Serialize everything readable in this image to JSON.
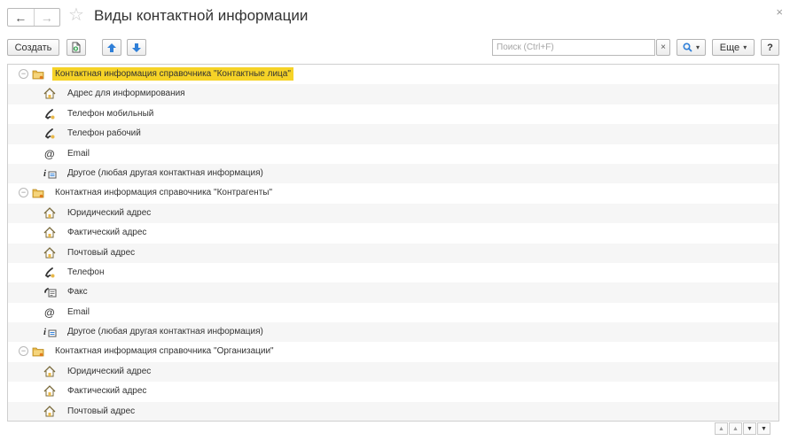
{
  "window": {
    "back_label": "←",
    "forward_label": "→",
    "favorite_glyph": "☆",
    "title": "Виды контактной информации",
    "close_glyph": "×"
  },
  "toolbar": {
    "create_label": "Создать",
    "search_placeholder": "Поиск (Ctrl+F)",
    "clear_glyph": "×",
    "more_label": "Еще",
    "help_label": "?"
  },
  "groups": [
    {
      "label": "Контактная информация справочника \"Контактные лица\"",
      "selected": true,
      "items": [
        {
          "label": "Адрес для информирования",
          "icon": "address-icon"
        },
        {
          "label": "Телефон мобильный",
          "icon": "phone-icon"
        },
        {
          "label": "Телефон рабочий",
          "icon": "phone-icon"
        },
        {
          "label": "Email",
          "icon": "email-icon"
        },
        {
          "label": "Другое (любая другая контактная информация)",
          "icon": "other-info-icon"
        }
      ]
    },
    {
      "label": "Контактная информация справочника \"Контрагенты\"",
      "selected": false,
      "items": [
        {
          "label": "Юридический адрес",
          "icon": "address-icon"
        },
        {
          "label": "Фактический адрес",
          "icon": "address-icon"
        },
        {
          "label": "Почтовый адрес",
          "icon": "address-icon"
        },
        {
          "label": "Телефон",
          "icon": "phone-icon"
        },
        {
          "label": "Факс",
          "icon": "fax-icon"
        },
        {
          "label": "Email",
          "icon": "email-icon"
        },
        {
          "label": "Другое (любая другая контактная информация)",
          "icon": "other-info-icon"
        }
      ]
    },
    {
      "label": "Контактная информация справочника \"Организации\"",
      "selected": false,
      "items": [
        {
          "label": "Юридический адрес",
          "icon": "address-icon"
        },
        {
          "label": "Фактический адрес",
          "icon": "address-icon"
        },
        {
          "label": "Почтовый адрес",
          "icon": "address-icon"
        }
      ]
    }
  ],
  "colors": {
    "selection": "#f6d327",
    "folder": "#e8b84a",
    "arrow_blue": "#2f7fd8",
    "copy_green": "#3aa655"
  }
}
